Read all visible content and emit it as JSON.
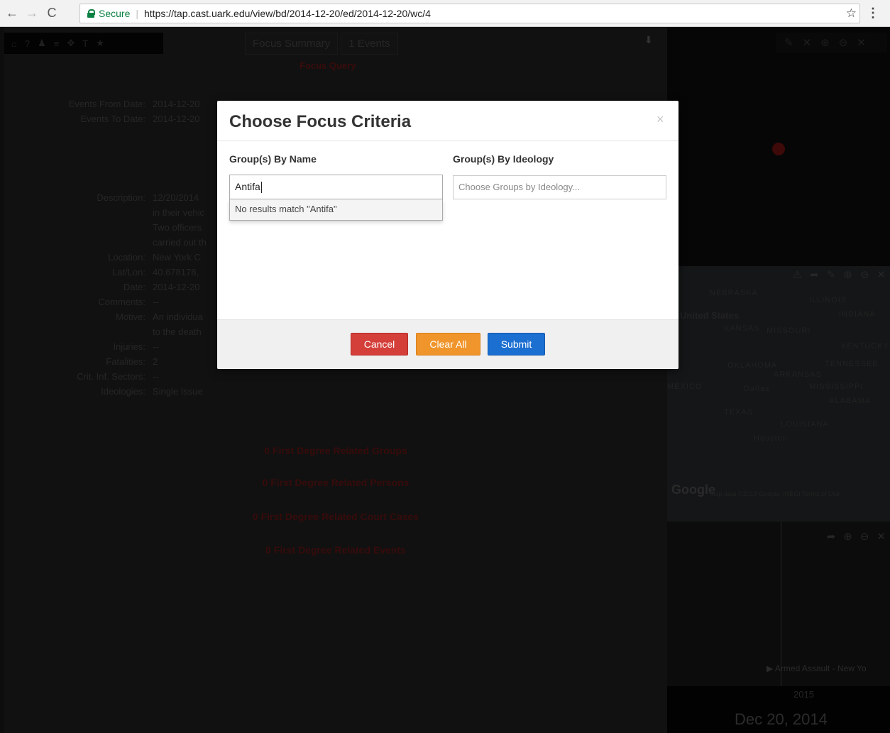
{
  "browser": {
    "secure_label": "Secure",
    "url": "https://tap.cast.uark.edu/view/bd/2014-12-20/ed/2014-12-20/wc/4",
    "back_glyph": "←",
    "forward_glyph": "→",
    "reload_glyph": "C",
    "star_glyph": "☆",
    "menu_glyph": "⋮"
  },
  "background": {
    "toolbar_icons": [
      "⌂",
      "?",
      "♟",
      "≡",
      "✥",
      "T",
      "★"
    ],
    "tabs": [
      "Focus Summary",
      "1 Events"
    ],
    "download_glyph": "⬇",
    "focus_query": "Focus Query",
    "fields": [
      {
        "label": "Events From Date:",
        "value": "2014-12-20"
      },
      {
        "label": "Events To Date:",
        "value": "2014-12-20"
      },
      {
        "label": "Description:",
        "value": "12/20/2014"
      },
      {
        "label": "",
        "value": "in their vehic"
      },
      {
        "label": "",
        "value": "Two officers"
      },
      {
        "label": "",
        "value": "carried out th"
      },
      {
        "label": "Location:",
        "value": "New York C"
      },
      {
        "label": "Lat/Lon:",
        "value": "40.678178,"
      },
      {
        "label": "Date:",
        "value": "2014-12-20"
      },
      {
        "label": "Comments:",
        "value": "--"
      },
      {
        "label": "Motive:",
        "value": "An individua"
      },
      {
        "label": "",
        "value": "to the death"
      },
      {
        "label": "Injuries:",
        "value": "--"
      },
      {
        "label": "Fatalities:",
        "value": "2"
      },
      {
        "label": "Crit. Inf. Sectors:",
        "value": "--"
      },
      {
        "label": "Ideologies:",
        "value": "Single Issue"
      }
    ],
    "related": [
      "0 First Degree Related Groups",
      "0 First Degree Related Persons",
      "0 First Degree Related Court Cases",
      "0 First Degree Related Events"
    ],
    "map_labels": [
      "NEBRASKA",
      "ILLINOIS",
      "United States",
      "KANSAS",
      "MISSOURI",
      "INDIANA",
      "KENTUCKY",
      "OKLAHOMA",
      "ARKANSAS",
      "TENNESSEE",
      "MEXICO",
      "Dallas",
      "MISSISSIPPI",
      "ALABAMA",
      "TEXAS",
      "LOUISIANA",
      "Houston"
    ],
    "map_google": "Google",
    "map_attribution": "Map data ©2018 Google, INEGI  Terms of Use",
    "timeline_event": "▶ Armed Assault - New Yo",
    "timeline_year": "2015",
    "timeline_date": "Dec 20, 2014",
    "map_tool_glyphs": [
      "⚠",
      "➦",
      "✎",
      "⊕",
      "⊖",
      "✕"
    ],
    "top_tool_glyphs": [
      "✎",
      "✕",
      "⊕",
      "⊖",
      "✕"
    ],
    "tl_tool_glyphs": [
      "➦",
      "⊕",
      "⊖",
      "✕"
    ]
  },
  "modal": {
    "title": "Choose Focus Criteria",
    "close_glyph": "×",
    "by_name_label": "Group(s) By Name",
    "by_name_value": "Antifa",
    "no_results": "No results match \"Antifa\"",
    "by_ideology_label": "Group(s) By Ideology",
    "by_ideology_placeholder": "Choose Groups by Ideology...",
    "cancel": "Cancel",
    "clear_all": "Clear All",
    "submit": "Submit"
  }
}
